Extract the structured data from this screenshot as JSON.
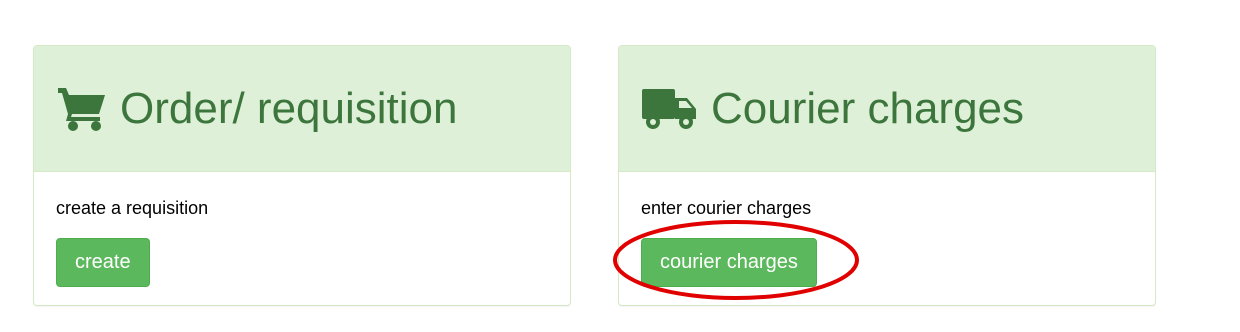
{
  "order_panel": {
    "title": "Order/ requisition",
    "icon": "shopping-cart-icon",
    "description": "create a requisition",
    "button_label": "create"
  },
  "courier_panel": {
    "title": "Courier charges",
    "icon": "truck-icon",
    "description": "enter courier charges",
    "button_label": "courier charges"
  },
  "colors": {
    "heading_bg": "#dff0d8",
    "heading_text": "#3c763d",
    "button_bg": "#5cb85c",
    "highlight": "#e00000"
  }
}
